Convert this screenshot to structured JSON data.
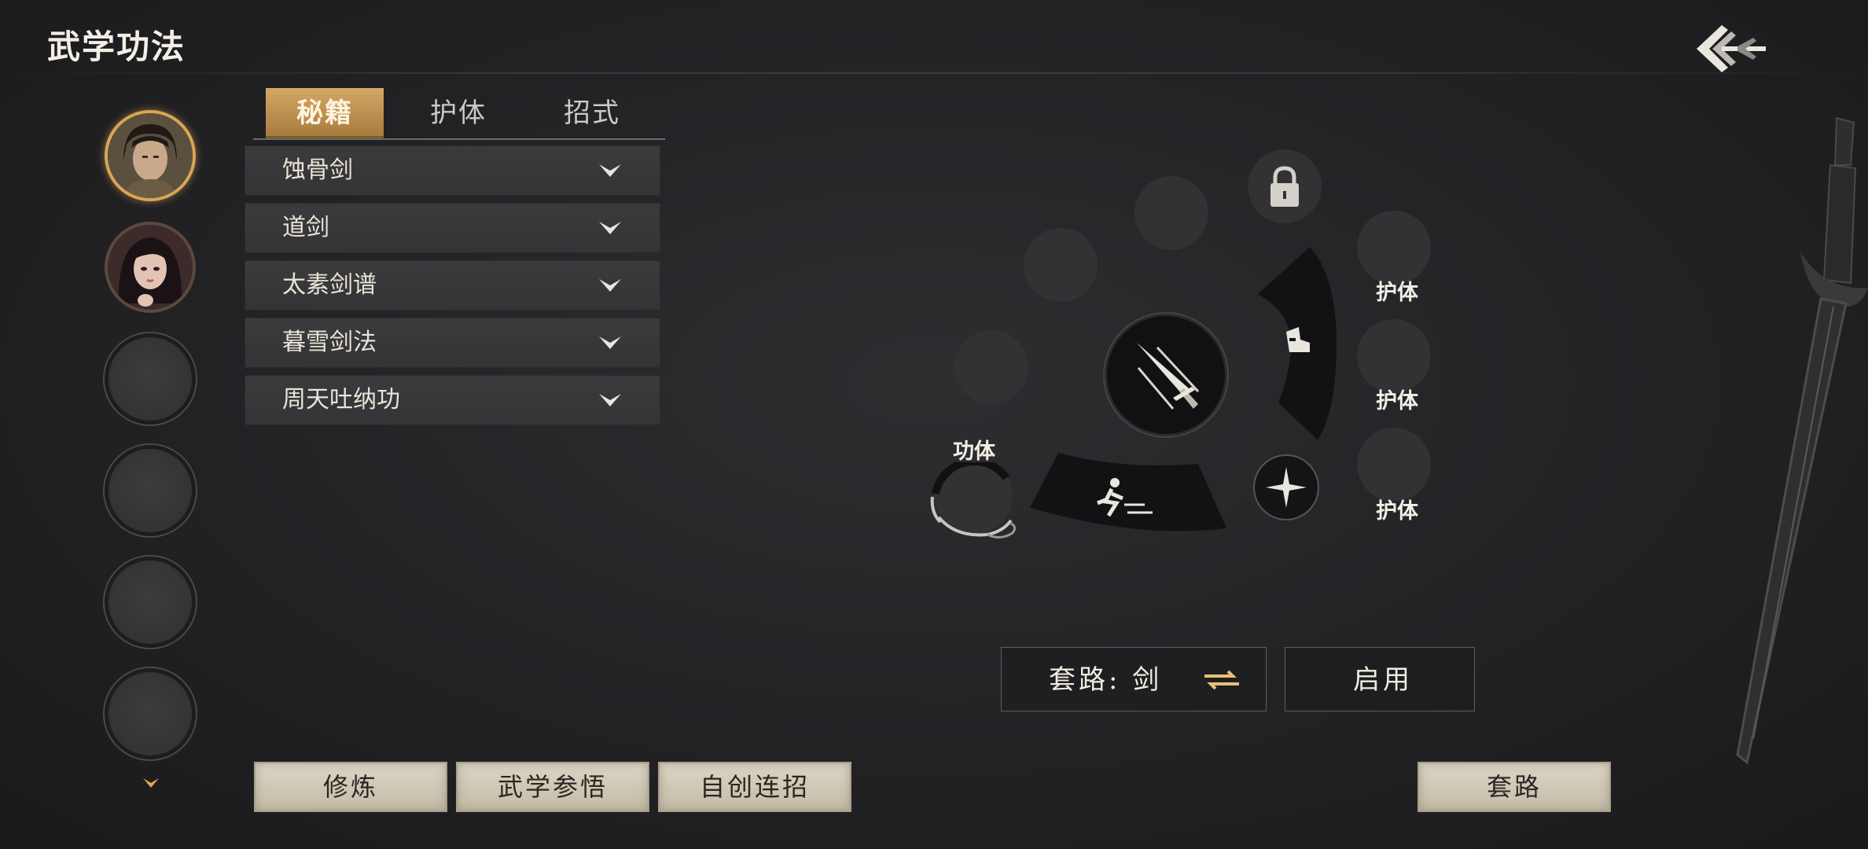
{
  "header": {
    "title": "武学功法"
  },
  "tabs": [
    {
      "label": "秘籍",
      "active": true
    },
    {
      "label": "护体",
      "active": false
    },
    {
      "label": "招式",
      "active": false
    }
  ],
  "manuals": [
    {
      "name": "蚀骨剑"
    },
    {
      "name": "道剑"
    },
    {
      "name": "太素剑谱"
    },
    {
      "name": "暮雪剑法"
    },
    {
      "name": "周天吐纳功"
    }
  ],
  "wheel": {
    "huti_labels": [
      "护体",
      "护体",
      "护体"
    ],
    "gongti_label": "功体"
  },
  "set_panel": {
    "set_label": "套路: 剑",
    "enable_label": "启用"
  },
  "bottom_buttons": {
    "practice": "修炼",
    "comprehend": "武学参悟",
    "create_combo": "自创连招",
    "routine": "套路"
  },
  "colors": {
    "accent_gold": "#d6a766",
    "background": "#242427",
    "paper_button": "#cfc8b6"
  }
}
